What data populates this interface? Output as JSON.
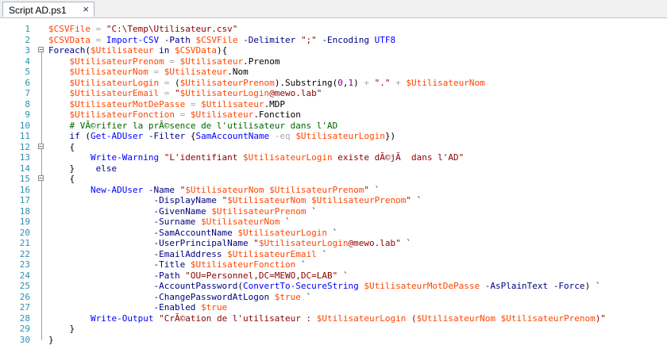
{
  "tab": {
    "title": "Script AD.ps1",
    "close_glyph": "×"
  },
  "lines": [
    {
      "n": "1",
      "fold": "",
      "tokens": [
        {
          "c": "var",
          "t": "$CSVFile"
        },
        {
          "c": "op",
          "t": " = "
        },
        {
          "c": "str",
          "t": "\"C:\\Temp\\Utilisateur.csv\""
        }
      ]
    },
    {
      "n": "2",
      "fold": "",
      "tokens": [
        {
          "c": "var",
          "t": "$CSVData"
        },
        {
          "c": "op",
          "t": " = "
        },
        {
          "c": "cmd",
          "t": "Import-CSV"
        },
        {
          "c": "txt",
          "t": " "
        },
        {
          "c": "par",
          "t": "-Path"
        },
        {
          "c": "txt",
          "t": " "
        },
        {
          "c": "var",
          "t": "$CSVFile"
        },
        {
          "c": "txt",
          "t": " "
        },
        {
          "c": "par",
          "t": "-Delimiter"
        },
        {
          "c": "txt",
          "t": " "
        },
        {
          "c": "str",
          "t": "\";\""
        },
        {
          "c": "txt",
          "t": " "
        },
        {
          "c": "par",
          "t": "-Encoding"
        },
        {
          "c": "txt",
          "t": " "
        },
        {
          "c": "cmd",
          "t": "UTF8"
        }
      ]
    },
    {
      "n": "3",
      "fold": "⊟",
      "tokens": [
        {
          "c": "kw",
          "t": "Foreach"
        },
        {
          "c": "txt",
          "t": "("
        },
        {
          "c": "var",
          "t": "$Utilisateur"
        },
        {
          "c": "txt",
          "t": " "
        },
        {
          "c": "kw",
          "t": "in"
        },
        {
          "c": "txt",
          "t": " "
        },
        {
          "c": "var",
          "t": "$CSVData"
        },
        {
          "c": "txt",
          "t": "){"
        }
      ]
    },
    {
      "n": "4",
      "fold": "",
      "tokens": [
        {
          "c": "txt",
          "t": "    "
        },
        {
          "c": "var",
          "t": "$UtilisateurPrenom"
        },
        {
          "c": "op",
          "t": " = "
        },
        {
          "c": "var",
          "t": "$Utilisateur"
        },
        {
          "c": "txt",
          "t": ".Prenom"
        }
      ]
    },
    {
      "n": "5",
      "fold": "",
      "tokens": [
        {
          "c": "txt",
          "t": "    "
        },
        {
          "c": "var",
          "t": "$UtilisateurNom"
        },
        {
          "c": "op",
          "t": " = "
        },
        {
          "c": "var",
          "t": "$Utilisateur"
        },
        {
          "c": "txt",
          "t": ".Nom"
        }
      ]
    },
    {
      "n": "6",
      "fold": "",
      "tokens": [
        {
          "c": "txt",
          "t": "    "
        },
        {
          "c": "var",
          "t": "$UtilisateurLogin"
        },
        {
          "c": "op",
          "t": " = "
        },
        {
          "c": "txt",
          "t": "("
        },
        {
          "c": "var",
          "t": "$UtilisateurPrenom"
        },
        {
          "c": "txt",
          "t": ").Substring("
        },
        {
          "c": "num",
          "t": "0"
        },
        {
          "c": "txt",
          "t": ","
        },
        {
          "c": "num",
          "t": "1"
        },
        {
          "c": "txt",
          "t": ") "
        },
        {
          "c": "op",
          "t": "+"
        },
        {
          "c": "txt",
          "t": " "
        },
        {
          "c": "str",
          "t": "\".\""
        },
        {
          "c": "txt",
          "t": " "
        },
        {
          "c": "op",
          "t": "+"
        },
        {
          "c": "txt",
          "t": " "
        },
        {
          "c": "var",
          "t": "$UtilisateurNom"
        }
      ]
    },
    {
      "n": "7",
      "fold": "",
      "tokens": [
        {
          "c": "txt",
          "t": "    "
        },
        {
          "c": "var",
          "t": "$UtilisateurEmail"
        },
        {
          "c": "op",
          "t": " = "
        },
        {
          "c": "str",
          "t": "\""
        },
        {
          "c": "var",
          "t": "$UtilisateurLogin"
        },
        {
          "c": "str",
          "t": "@mewo.lab\""
        }
      ]
    },
    {
      "n": "8",
      "fold": "",
      "tokens": [
        {
          "c": "txt",
          "t": "    "
        },
        {
          "c": "var",
          "t": "$UtilisateurMotDePasse"
        },
        {
          "c": "op",
          "t": " = "
        },
        {
          "c": "var",
          "t": "$Utilisateur"
        },
        {
          "c": "txt",
          "t": ".MDP"
        }
      ]
    },
    {
      "n": "9",
      "fold": "",
      "tokens": [
        {
          "c": "txt",
          "t": "    "
        },
        {
          "c": "var",
          "t": "$UtilisateurFonction"
        },
        {
          "c": "op",
          "t": " = "
        },
        {
          "c": "var",
          "t": "$Utilisateur"
        },
        {
          "c": "txt",
          "t": ".Fonction"
        }
      ]
    },
    {
      "n": "10",
      "fold": "",
      "tokens": [
        {
          "c": "txt",
          "t": "    "
        },
        {
          "c": "cmt",
          "t": "# VÃ©rifier la prÃ©sence de l'utilisateur dans l'AD"
        }
      ]
    },
    {
      "n": "11",
      "fold": "",
      "tokens": [
        {
          "c": "txt",
          "t": "    "
        },
        {
          "c": "kw",
          "t": "if"
        },
        {
          "c": "txt",
          "t": " ("
        },
        {
          "c": "cmd",
          "t": "Get-ADUser"
        },
        {
          "c": "txt",
          "t": " "
        },
        {
          "c": "par",
          "t": "-Filter"
        },
        {
          "c": "txt",
          "t": " {"
        },
        {
          "c": "cmd",
          "t": "SamAccountName"
        },
        {
          "c": "txt",
          "t": " "
        },
        {
          "c": "op",
          "t": "-eq"
        },
        {
          "c": "txt",
          "t": " "
        },
        {
          "c": "var",
          "t": "$UtilisateurLogin"
        },
        {
          "c": "txt",
          "t": "})"
        }
      ]
    },
    {
      "n": "12",
      "fold": "⊟",
      "tokens": [
        {
          "c": "txt",
          "t": "    {"
        }
      ]
    },
    {
      "n": "13",
      "fold": "",
      "tokens": [
        {
          "c": "txt",
          "t": "        "
        },
        {
          "c": "cmd",
          "t": "Write-Warning"
        },
        {
          "c": "txt",
          "t": " "
        },
        {
          "c": "str",
          "t": "\"L'identifiant "
        },
        {
          "c": "var",
          "t": "$UtilisateurLogin"
        },
        {
          "c": "str",
          "t": " existe dÃ©jÃ  dans l'AD\""
        }
      ]
    },
    {
      "n": "14",
      "fold": "",
      "tokens": [
        {
          "c": "txt",
          "t": "    }    "
        },
        {
          "c": "kw",
          "t": "else"
        }
      ]
    },
    {
      "n": "15",
      "fold": "⊟",
      "tokens": [
        {
          "c": "txt",
          "t": "    {"
        }
      ]
    },
    {
      "n": "16",
      "fold": "",
      "tokens": [
        {
          "c": "txt",
          "t": "        "
        },
        {
          "c": "cmd",
          "t": "New-ADUser"
        },
        {
          "c": "txt",
          "t": " "
        },
        {
          "c": "par",
          "t": "-Name"
        },
        {
          "c": "txt",
          "t": " "
        },
        {
          "c": "str",
          "t": "\""
        },
        {
          "c": "var",
          "t": "$UtilisateurNom"
        },
        {
          "c": "str",
          "t": " "
        },
        {
          "c": "var",
          "t": "$UtilisateurPrenom"
        },
        {
          "c": "str",
          "t": "\""
        },
        {
          "c": "txt",
          "t": " `"
        }
      ]
    },
    {
      "n": "17",
      "fold": "",
      "tokens": [
        {
          "c": "txt",
          "t": "                    "
        },
        {
          "c": "par",
          "t": "-DisplayName"
        },
        {
          "c": "txt",
          "t": " "
        },
        {
          "c": "str",
          "t": "\""
        },
        {
          "c": "var",
          "t": "$UtilisateurNom"
        },
        {
          "c": "str",
          "t": " "
        },
        {
          "c": "var",
          "t": "$UtilisateurPrenom"
        },
        {
          "c": "str",
          "t": "\""
        },
        {
          "c": "txt",
          "t": " `"
        }
      ]
    },
    {
      "n": "18",
      "fold": "",
      "tokens": [
        {
          "c": "txt",
          "t": "                    "
        },
        {
          "c": "par",
          "t": "-GivenName"
        },
        {
          "c": "txt",
          "t": " "
        },
        {
          "c": "var",
          "t": "$UtilisateurPrenom"
        },
        {
          "c": "txt",
          "t": " `"
        }
      ]
    },
    {
      "n": "19",
      "fold": "",
      "tokens": [
        {
          "c": "txt",
          "t": "                    "
        },
        {
          "c": "par",
          "t": "-Surname"
        },
        {
          "c": "txt",
          "t": " "
        },
        {
          "c": "var",
          "t": "$UtilisateurNom"
        },
        {
          "c": "txt",
          "t": " `"
        }
      ]
    },
    {
      "n": "20",
      "fold": "",
      "tokens": [
        {
          "c": "txt",
          "t": "                    "
        },
        {
          "c": "par",
          "t": "-SamAccountName"
        },
        {
          "c": "txt",
          "t": " "
        },
        {
          "c": "var",
          "t": "$UtilisateurLogin"
        },
        {
          "c": "txt",
          "t": " `"
        }
      ]
    },
    {
      "n": "21",
      "fold": "",
      "tokens": [
        {
          "c": "txt",
          "t": "                    "
        },
        {
          "c": "par",
          "t": "-UserPrincipalName"
        },
        {
          "c": "txt",
          "t": " "
        },
        {
          "c": "str",
          "t": "\""
        },
        {
          "c": "var",
          "t": "$UtilisateurLogin"
        },
        {
          "c": "str",
          "t": "@mewo.lab\""
        },
        {
          "c": "txt",
          "t": " `"
        }
      ]
    },
    {
      "n": "22",
      "fold": "",
      "tokens": [
        {
          "c": "txt",
          "t": "                    "
        },
        {
          "c": "par",
          "t": "-EmailAddress"
        },
        {
          "c": "txt",
          "t": " "
        },
        {
          "c": "var",
          "t": "$UtilisateurEmail"
        },
        {
          "c": "txt",
          "t": " `"
        }
      ]
    },
    {
      "n": "23",
      "fold": "",
      "tokens": [
        {
          "c": "txt",
          "t": "                    "
        },
        {
          "c": "par",
          "t": "-Title"
        },
        {
          "c": "txt",
          "t": " "
        },
        {
          "c": "var",
          "t": "$UtilisateurFonction"
        },
        {
          "c": "txt",
          "t": " `"
        }
      ]
    },
    {
      "n": "24",
      "fold": "",
      "tokens": [
        {
          "c": "txt",
          "t": "                    "
        },
        {
          "c": "par",
          "t": "-Path"
        },
        {
          "c": "txt",
          "t": " "
        },
        {
          "c": "str",
          "t": "\"OU=Personnel,DC=MEWO,DC=LAB\""
        },
        {
          "c": "txt",
          "t": " `"
        }
      ]
    },
    {
      "n": "25",
      "fold": "",
      "tokens": [
        {
          "c": "txt",
          "t": "                    "
        },
        {
          "c": "par",
          "t": "-AccountPassword"
        },
        {
          "c": "txt",
          "t": "("
        },
        {
          "c": "cmd",
          "t": "ConvertTo-SecureString"
        },
        {
          "c": "txt",
          "t": " "
        },
        {
          "c": "var",
          "t": "$UtilisateurMotDePasse"
        },
        {
          "c": "txt",
          "t": " "
        },
        {
          "c": "par",
          "t": "-AsPlainText"
        },
        {
          "c": "txt",
          "t": " "
        },
        {
          "c": "par",
          "t": "-Force"
        },
        {
          "c": "txt",
          "t": ") `"
        }
      ]
    },
    {
      "n": "26",
      "fold": "",
      "tokens": [
        {
          "c": "txt",
          "t": "                    "
        },
        {
          "c": "par",
          "t": "-ChangePasswordAtLogon"
        },
        {
          "c": "txt",
          "t": " "
        },
        {
          "c": "var",
          "t": "$true"
        },
        {
          "c": "txt",
          "t": " `"
        }
      ]
    },
    {
      "n": "27",
      "fold": "",
      "tokens": [
        {
          "c": "txt",
          "t": "                    "
        },
        {
          "c": "par",
          "t": "-Enabled"
        },
        {
          "c": "txt",
          "t": " "
        },
        {
          "c": "var",
          "t": "$true"
        }
      ]
    },
    {
      "n": "28",
      "fold": "",
      "tokens": [
        {
          "c": "txt",
          "t": "        "
        },
        {
          "c": "cmd",
          "t": "Write-Output"
        },
        {
          "c": "txt",
          "t": " "
        },
        {
          "c": "str",
          "t": "\"CrÃ©ation de l'utilisateur : "
        },
        {
          "c": "var",
          "t": "$UtilisateurLogin"
        },
        {
          "c": "str",
          "t": " ("
        },
        {
          "c": "var",
          "t": "$UtilisateurNom"
        },
        {
          "c": "str",
          "t": " "
        },
        {
          "c": "var",
          "t": "$UtilisateurPrenom"
        },
        {
          "c": "str",
          "t": ")\""
        }
      ]
    },
    {
      "n": "29",
      "fold": "",
      "tokens": [
        {
          "c": "txt",
          "t": "    }"
        }
      ]
    },
    {
      "n": "30",
      "fold": "",
      "tokens": [
        {
          "c": "txt",
          "t": "}"
        }
      ]
    }
  ]
}
